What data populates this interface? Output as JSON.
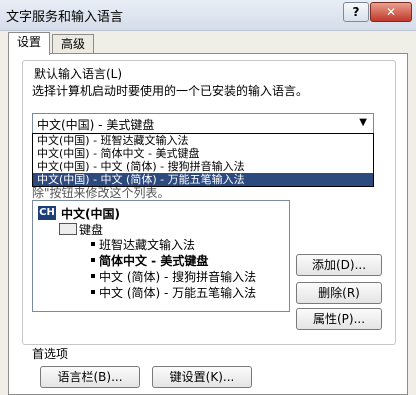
{
  "window": {
    "title": "文字服务和输入语言",
    "help": "?",
    "close": "✕"
  },
  "tabs": [
    {
      "label": "设置"
    },
    {
      "label": "高级"
    }
  ],
  "default_language": {
    "label": "默认输入语言(L)",
    "description": "选择计算机启动时要使用的一个已安装的输入语言。",
    "selected": "中文(中国) - 美式键盘",
    "options": [
      "中文(中国) - 班智达藏文输入法",
      "中文(中国) - 简体中文 - 美式键盘",
      "中文(中国) - 中文 (简体) - 搜狗拼音输入法",
      "中文(中国) - 中文 (简体) - 万能五笔输入法"
    ],
    "selected_option_index": 3
  },
  "installed_services": {
    "partial_text": "除\"按钮来修改这个列表。",
    "tree": {
      "language_badge": "CH",
      "language": "中文(中国)",
      "category": "键盘",
      "items": [
        "班智达藏文输入法",
        "简体中文 - 美式键盘",
        "中文 (简体) - 搜狗拼音输入法",
        "中文 (简体) - 万能五笔输入法"
      ]
    },
    "buttons": {
      "add": "添加(D)...",
      "remove": "删除(R)",
      "properties": "属性(P)..."
    }
  },
  "preferences": {
    "label": "首选项",
    "language_bar": "语言栏(B)...",
    "key_settings": "键设置(K)..."
  }
}
